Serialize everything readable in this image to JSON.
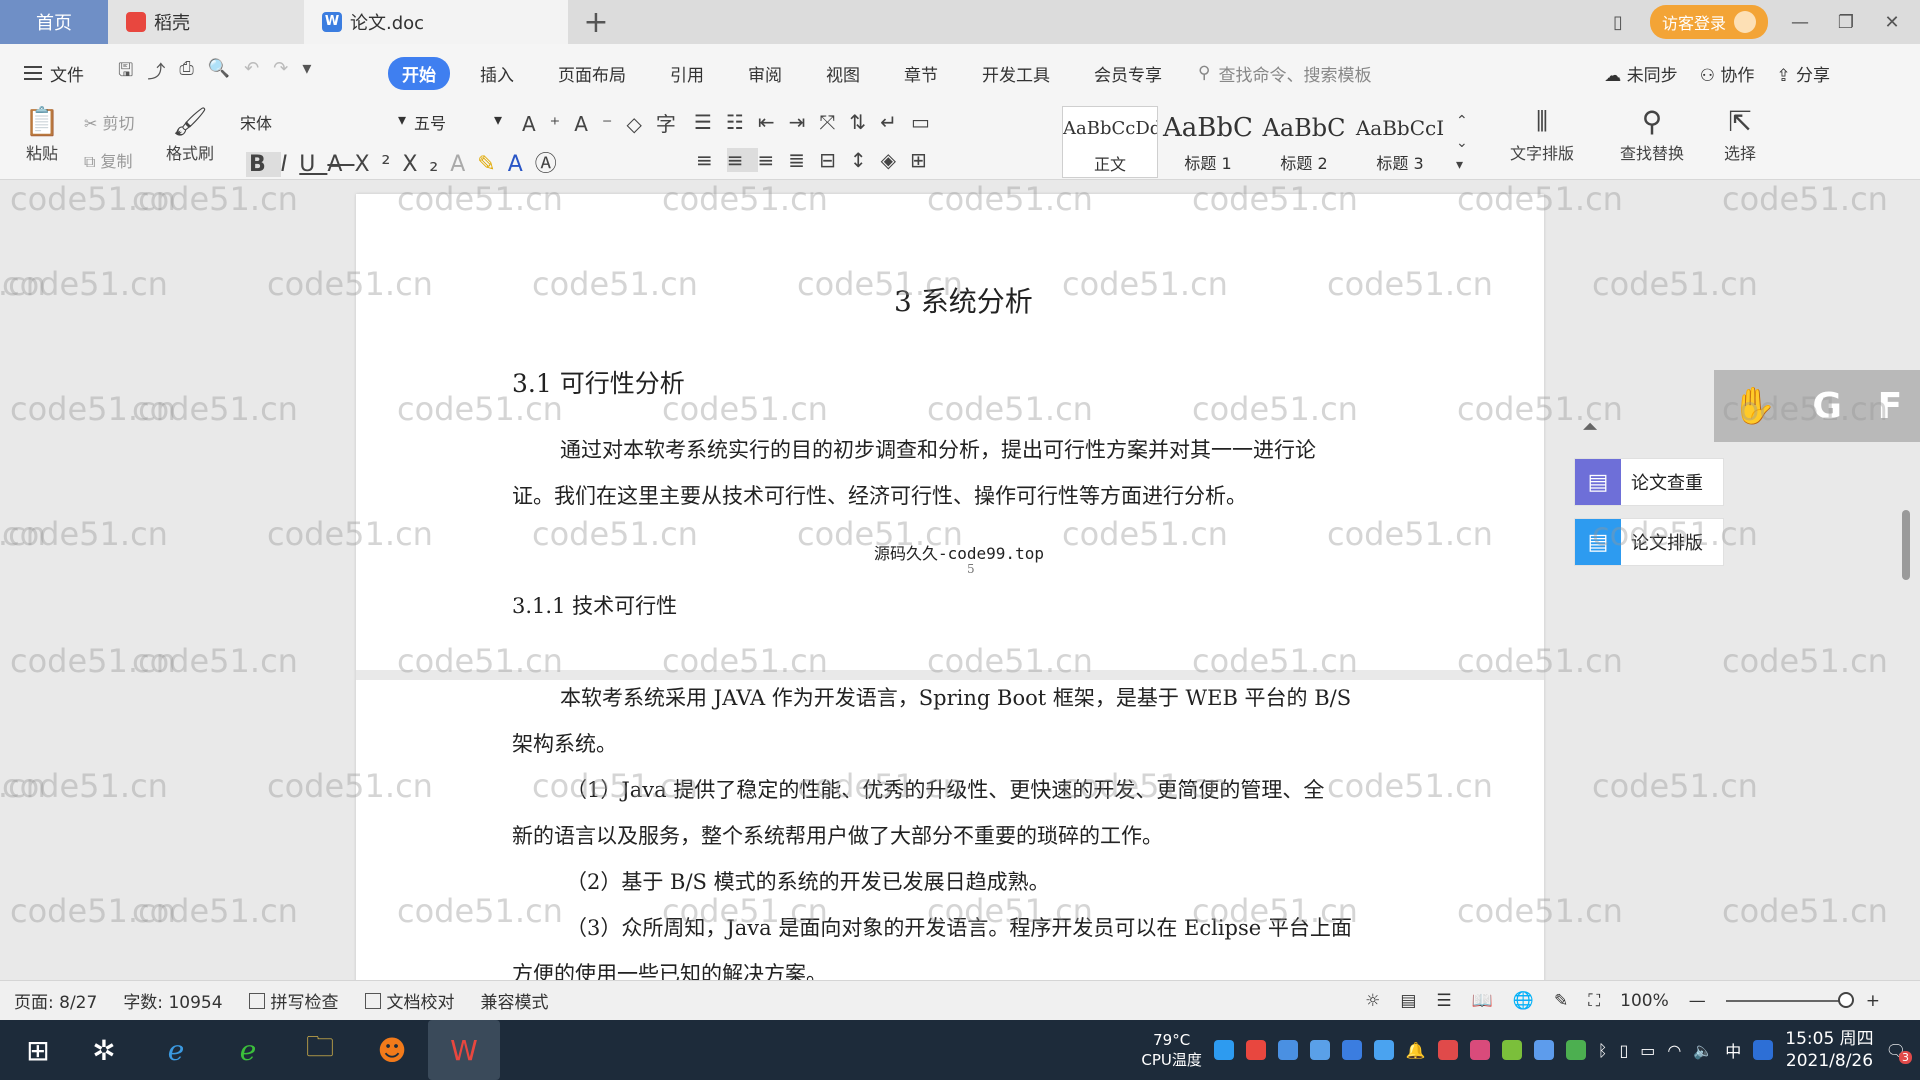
{
  "tabs": {
    "home": "首页",
    "daoke": "稻壳",
    "doc": "论文.doc",
    "add": "+",
    "visitor_login": "访客登录"
  },
  "menu": {
    "file": "文件",
    "items": [
      "开始",
      "插入",
      "页面布局",
      "引用",
      "审阅",
      "视图",
      "章节",
      "开发工具",
      "会员专享"
    ],
    "active": "开始",
    "search_commands": "查找命令、搜索模板",
    "unsynced": "未同步",
    "collaborate": "协作",
    "share": "分享"
  },
  "ribbon": {
    "paste": "粘贴",
    "cut": "剪切",
    "copy": "复制",
    "format_painter": "格式刷",
    "font_name": "宋体",
    "font_size": "五号",
    "styles": [
      {
        "sample": "AaBbCcDd",
        "label": "正文"
      },
      {
        "sample": "AaBbC",
        "label": "标题 1"
      },
      {
        "sample": "AaBbC",
        "label": "标题 2"
      },
      {
        "sample": "AaBbCcI",
        "label": "标题 3"
      }
    ],
    "text_layout": "文字排版",
    "find_replace": "查找替换",
    "select": "选择"
  },
  "document": {
    "chapter_title": "3 系统分析",
    "section_title": "3.1 可行性分析",
    "para1_line1": "通过对本软考系统实行的目的初步调查和分析，提出可行性方案并对其一一进行论",
    "para1_line2": "证。我们在这里主要从技术可行性、经济可行性、操作可行性等方面进行分析。",
    "banner": "源码久久-code99.top",
    "page_number": "5",
    "subsection_title": "3.1.1 技术可行性",
    "para2_line1": "本软考系统采用 JAVA 作为开发语言，Spring Boot 框架，是基于 WEB 平台的 B/S",
    "para2_line2": "架构系统。",
    "item1_line1": "（1）Java 提供了稳定的性能、优秀的升级性、更快速的开发、更简便的管理、全",
    "item1_line2": "新的语言以及服务，整个系统帮用户做了大部分不重要的琐碎的工作。",
    "item2_line1": "（2）基于 B/S 模式的系统的开发已发展日趋成熟。",
    "item3_line1": "（3）众所周知，Java 是面向对象的开发语言。程序开发员可以在 Eclipse 平台上面",
    "item3_line2": "方便的使用一些已知的解决方案。"
  },
  "watermark_text": "code51.cn",
  "side_panel": {
    "plagiarism_check": "论文查重",
    "thesis_format": "论文排版",
    "overlay_letters": [
      "G",
      "F"
    ]
  },
  "status": {
    "page": "页面: 8/27",
    "word_count": "字数: 10954",
    "spell_check": "拼写检查",
    "doc_proof": "文档校对",
    "compat_mode": "兼容模式",
    "zoom": "100%",
    "zoom_fraction": 1.0
  },
  "taskbar": {
    "temperature": "79°C",
    "cpu_label": "CPU温度",
    "ime": "中",
    "time": "15:05 周四",
    "date": "2021/8/26",
    "notification_count": "3"
  },
  "colors": {
    "accent": "#3f7ff0",
    "home_tab": "#6f8fc6",
    "visitor": "#f3a436",
    "taskbar": "#1d2b3a"
  }
}
